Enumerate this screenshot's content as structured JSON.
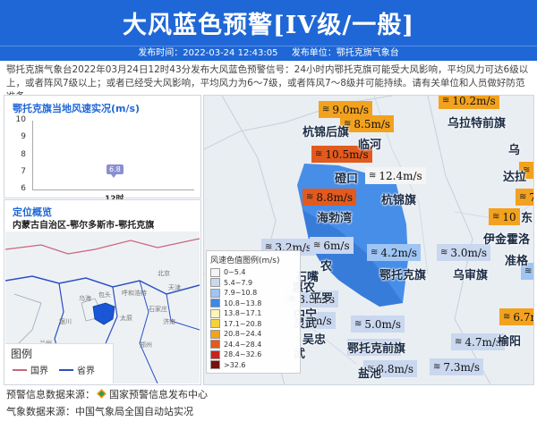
{
  "header": {
    "title": "大风蓝色预警[IV级/一般]",
    "publish_time": "发布时间：2022-03-24 12:43:05",
    "publish_unit": "发布单位：鄂托克旗气象台"
  },
  "description": "鄂托克旗气象台2022年03月24日12时43分发布大风蓝色预警信号：24小时内鄂托克旗可能受大风影响，平均风力可达6级以上，或者阵风7级以上；或者已经受大风影响，平均风力为6～7级，或者阵风7～8级并可能持续。请有关单位和人员做好防范准备。",
  "wind_panel": {
    "title": "鄂托克旗当地风速实况(m/s)",
    "chart_data": {
      "type": "line",
      "categories": [
        "12时"
      ],
      "values": [
        6.8
      ],
      "ylim": [
        6,
        10
      ],
      "yticks": [
        10,
        9,
        8,
        7,
        6
      ],
      "data_labels": [
        "6.8"
      ]
    }
  },
  "location_panel": {
    "title": "定位概览",
    "region": "内蒙古自治区-鄂尔多斯市-鄂托克旗",
    "cities": [
      "乌海",
      "包头",
      "呼和浩特",
      "北京",
      "天津",
      "石家庄",
      "太原",
      "银川",
      "兰州",
      "西安",
      "郑州",
      "济南"
    ],
    "legend": {
      "title": "图例",
      "items": [
        {
          "label": "国界",
          "color": "#c9657b"
        },
        {
          "label": "省界",
          "color": "#2a4fc4"
        }
      ]
    }
  },
  "map": {
    "stations": [
      "9.0m/s",
      "8.5m/s",
      "10.5m/s",
      "12.4m/s",
      "8.8m/s",
      "3.2m/s",
      "6m/s",
      "4.2m/s",
      "3.0m/s",
      "3m/s",
      "3.5m/s",
      "8m/s",
      "5.0m/s",
      "5.9m/s",
      "8.8m/s",
      "4.7m/s",
      "7.3m/s",
      "6.7m",
      "10.2m/s",
      "7.2",
      "7.",
      "10"
    ],
    "place_labels": [
      "杭锦后旗",
      "临河",
      "磴口",
      "杭锦旗",
      "海勃湾",
      "鄂托克旗",
      "乌审旗",
      "乌拉特前旗",
      "伊金霍洛",
      "达拉",
      "准格",
      "东",
      "乌",
      "榆阳",
      "鄂托克前旗",
      "盐池",
      "平罗",
      "武",
      "农",
      "石嘴",
      "惠农",
      "中宁",
      "吴忠",
      "灵武"
    ],
    "legend": {
      "title": "风速色值图例(m/s)",
      "items": [
        {
          "label": "0~5.4",
          "color": "#f4f4f4"
        },
        {
          "label": "5.4~7.9",
          "color": "#c9d7ef"
        },
        {
          "label": "7.9~10.8",
          "color": "#9fc5f4"
        },
        {
          "label": "10.8~13.8",
          "color": "#3e88e7"
        },
        {
          "label": "13.8~17.1",
          "color": "#fff3b8"
        },
        {
          "label": "17.1~20.8",
          "color": "#f4d23a"
        },
        {
          "label": "20.8~24.4",
          "color": "#f2a21f"
        },
        {
          "label": "24.4~28.4",
          "color": "#e25a1e"
        },
        {
          "label": "28.4~32.6",
          "color": "#c8241c"
        },
        {
          "label": ">32.6",
          "color": "#7b0d0d"
        }
      ]
    }
  },
  "footer": {
    "warning_source_label": "预警信息数据来源：",
    "warning_source": "国家预警信息发布中心",
    "weather_source_label": "气象数据来源：",
    "weather_source": "中国气象局全国自动站实况"
  }
}
